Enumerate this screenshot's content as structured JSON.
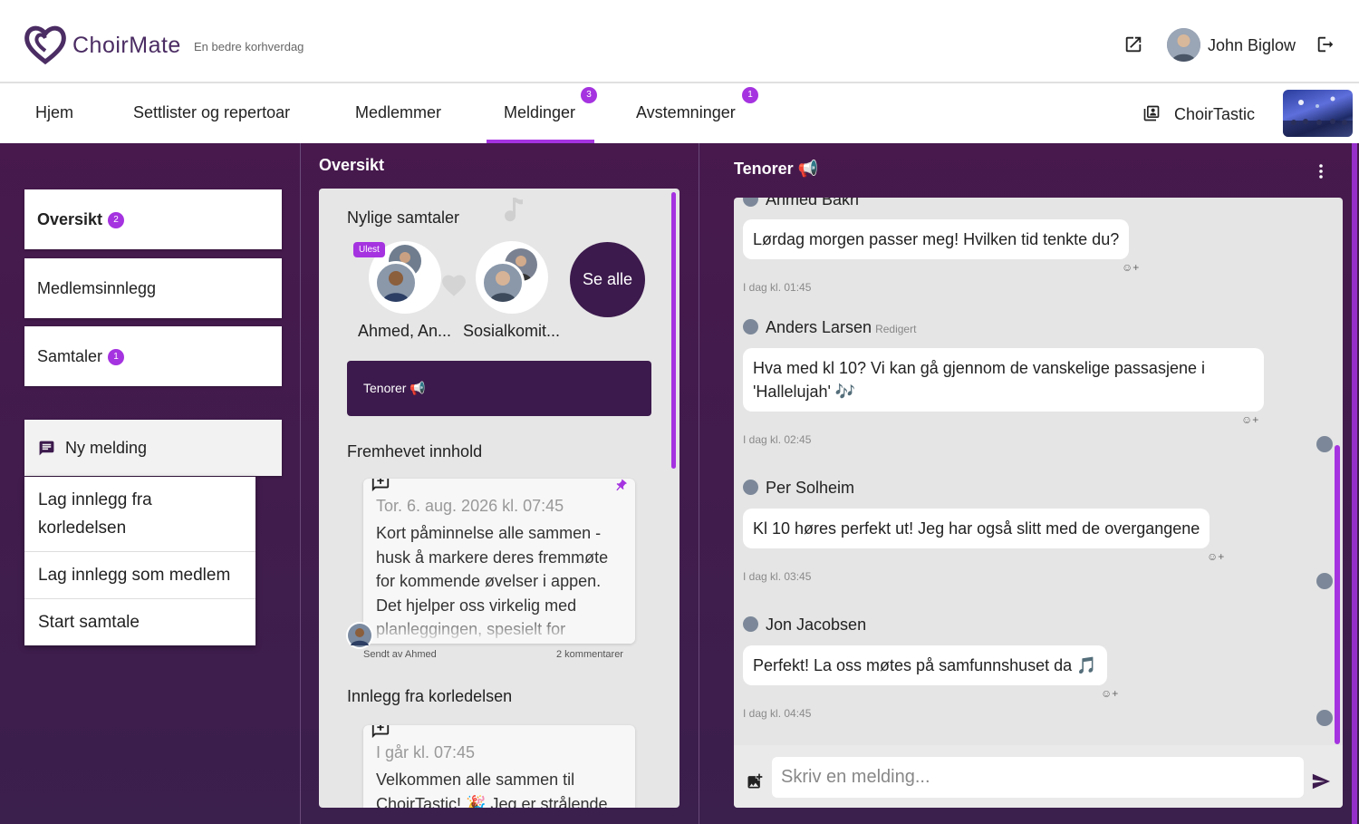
{
  "header": {
    "brand": "ChoirMate",
    "tagline": "En bedre korhverdag",
    "user_name": "John Biglow"
  },
  "nav": {
    "items": [
      {
        "label": "Hjem"
      },
      {
        "label": "Settlister og repertoar"
      },
      {
        "label": "Medlemmer"
      },
      {
        "label": "Meldinger",
        "badge": "3",
        "active": true
      },
      {
        "label": "Avstemninger",
        "badge": "1"
      }
    ],
    "choir_name": "ChoirTastic"
  },
  "sidebar": {
    "items": [
      {
        "label": "Oversikt",
        "badge": "2"
      },
      {
        "label": "Medlemsinnlegg"
      },
      {
        "label": "Samtaler",
        "badge": "1"
      }
    ],
    "new_message_label": "Ny melding",
    "menu": [
      {
        "label": "Lag innlegg fra korledelsen"
      },
      {
        "label": "Lag innlegg som medlem"
      },
      {
        "label": "Start samtale"
      }
    ]
  },
  "overview": {
    "title": "Oversikt",
    "recent_title": "Nylige samtaler",
    "unread_label": "Ulest",
    "conversations": [
      {
        "name": "Ahmed, An..."
      },
      {
        "name": "Sosialkomit..."
      }
    ],
    "see_all_label": "Se alle",
    "active_conversation": "Tenorer 📢",
    "featured_title": "Fremhevet innhold",
    "featured_post": {
      "date": "Tor. 6. aug. 2026 kl. 07:45",
      "body": "Kort påminnelse alle sammen - husk å markere deres fremmøte for kommende øvelser i appen. Det hjelper oss virkelig med planleggingen, spesielt for",
      "sent_by": "Sendt av Ahmed",
      "comments": "2 kommentarer"
    },
    "board_title": "Innlegg fra korledelsen",
    "board_post": {
      "date": "I går kl. 07:45",
      "body": "Velkommen alle sammen til ChoirTastic! 🎉 Jeg er strålende"
    }
  },
  "chat": {
    "title": "Tenorer 📢",
    "top_author": "Ahmed Bakri",
    "messages": [
      {
        "text": "Lørdag morgen passer meg! Hvilken tid tenkte du?",
        "time": "I dag kl. 01:45"
      },
      {
        "author": "Anders Larsen",
        "edited": "Redigert",
        "text": "Hva med kl 10? Vi kan gå gjennom de vanskelige passasjene i 'Hallelujah' 🎶",
        "time": "I dag kl. 02:45"
      },
      {
        "author": "Per Solheim",
        "text": "Kl 10 høres perfekt ut! Jeg har også slitt med de overgangene",
        "time": "I dag kl. 03:45"
      },
      {
        "author": "Jon Jacobsen",
        "text": "Perfekt! La oss møtes på samfunnshuset da 🎵",
        "time": "I dag kl. 04:45"
      }
    ],
    "input_placeholder": "Skriv en melding..."
  },
  "icons": {
    "logo": "heart-icon",
    "external": "external-link-icon",
    "logout": "logout-icon",
    "choir": "library-icon",
    "message": "message-icon",
    "post": "post-add-icon",
    "pin": "pin-icon",
    "image": "image-icon",
    "send": "send-icon",
    "more": "more-vert-icon",
    "reaction": "add-reaction-icon"
  },
  "colors": {
    "accent": "#a533e0",
    "dark_purple": "#3c1a4d",
    "brand": "#4b2c63"
  }
}
